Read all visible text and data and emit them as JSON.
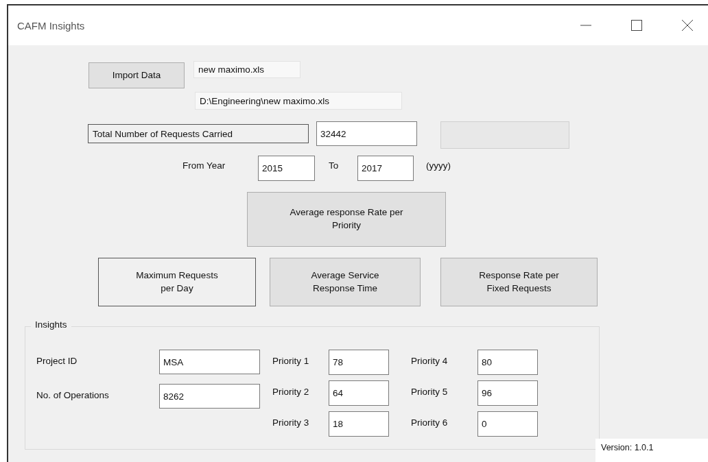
{
  "window": {
    "title": "CAFM Insights"
  },
  "import": {
    "button": "Import Data",
    "file_name": "new maximo.xls",
    "file_path": "D:\\Engineering\\new maximo.xls"
  },
  "total": {
    "label": "Total Number of Requests Carried",
    "value": "32442",
    "extra_field_disabled": true
  },
  "years": {
    "from_label": "From Year",
    "from_value": "2015",
    "to_label": "To",
    "to_value": "2017",
    "format_hint": "(yyyy)"
  },
  "top_button": {
    "label": "Average response Rate per Priority",
    "focused": false
  },
  "buttons": [
    {
      "label": "Maximum Requests per Day",
      "focused": true
    },
    {
      "label": "Average Service Response Time",
      "focused": false
    },
    {
      "label": "Response Rate per Fixed Requests",
      "focused": false
    }
  ],
  "insights": {
    "title": "Insights",
    "fields": [
      {
        "label": "Project ID",
        "value": "MSA"
      },
      {
        "label": "No. of Operations",
        "value": "8262"
      }
    ],
    "priorities": [
      {
        "label": "Priority 1",
        "value": "78"
      },
      {
        "label": "Priority 2",
        "value": "64"
      },
      {
        "label": "Priority 3",
        "value": "18"
      },
      {
        "label": "Priority 4",
        "value": "80"
      },
      {
        "label": "Priority 5",
        "value": "96"
      },
      {
        "label": "Priority 6",
        "value": "0"
      }
    ]
  },
  "version": "Version: 1.0.1"
}
